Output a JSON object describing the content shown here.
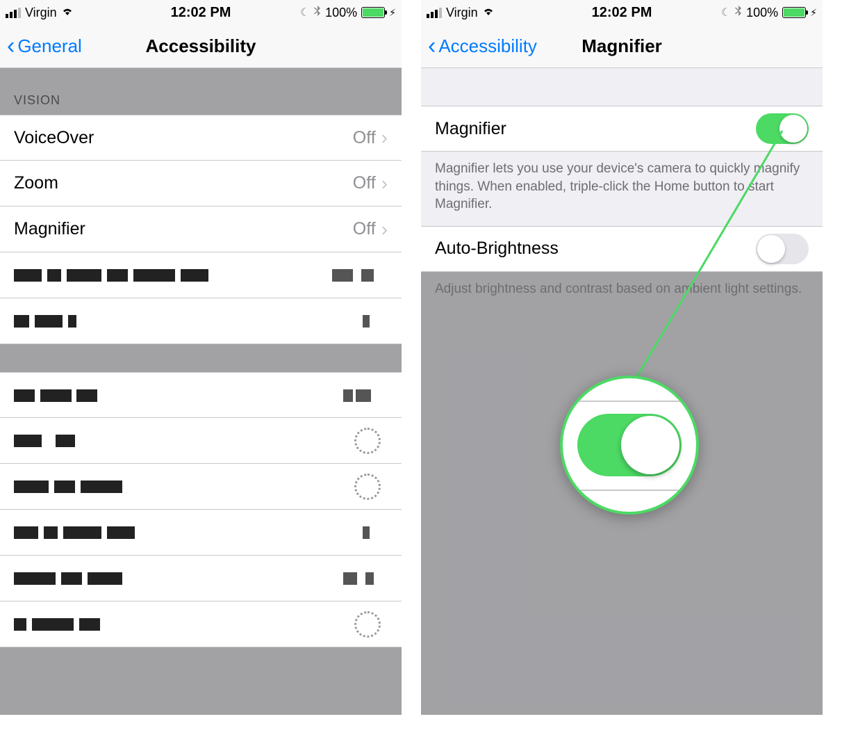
{
  "status": {
    "carrier": "Virgin",
    "time": "12:02 PM",
    "battery_pct": "100%"
  },
  "left": {
    "back_label": "General",
    "title": "Accessibility",
    "section_vision": "VISION",
    "rows": {
      "voiceover": {
        "label": "VoiceOver",
        "value": "Off"
      },
      "zoom": {
        "label": "Zoom",
        "value": "Off"
      },
      "magnifier": {
        "label": "Magnifier",
        "value": "Off"
      }
    }
  },
  "right": {
    "back_label": "Accessibility",
    "title": "Magnifier",
    "magnifier_row_label": "Magnifier",
    "magnifier_on": true,
    "magnifier_footer": "Magnifier lets you use your device's camera to quickly magnify things. When enabled, triple-click the Home button to start Magnifier.",
    "auto_brightness_label": "Auto-Brightness",
    "auto_brightness_on": false,
    "auto_brightness_footer": "Adjust brightness and contrast based on ambient light settings."
  }
}
